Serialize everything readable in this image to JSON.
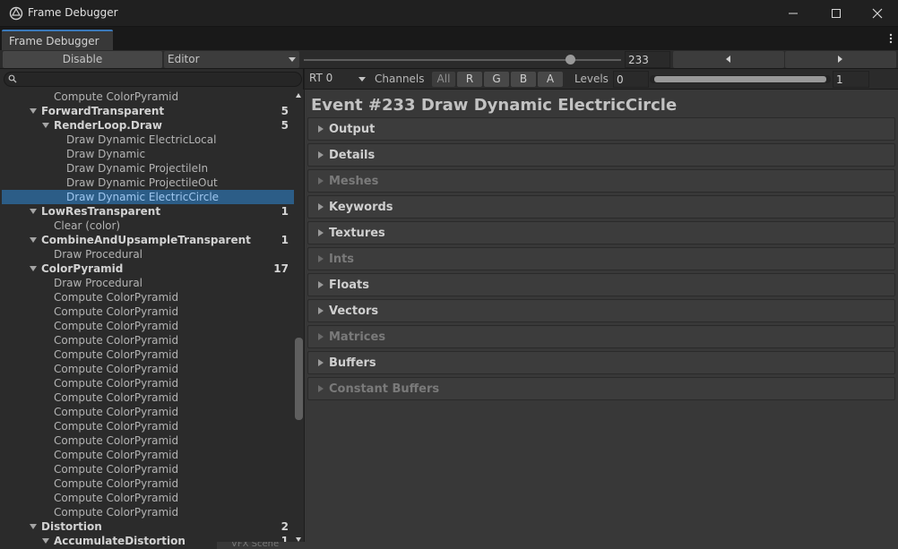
{
  "window": {
    "title": "Frame Debugger"
  },
  "tab": {
    "label": "Frame Debugger"
  },
  "toolbar": {
    "disable_label": "Disable",
    "target_label": "Editor",
    "event_index": "233",
    "slider_position": 0.84
  },
  "search": {
    "value": ""
  },
  "tree": [
    {
      "label": "Compute ColorPyramid",
      "depth": 2,
      "type": "leaf"
    },
    {
      "label": "ForwardTransparent",
      "depth": 1,
      "type": "group",
      "count": "5",
      "expanded": true
    },
    {
      "label": "RenderLoop.Draw",
      "depth": 2,
      "type": "group",
      "count": "5",
      "expanded": true
    },
    {
      "label": "Draw Dynamic ElectricLocal",
      "depth": 3,
      "type": "leaf"
    },
    {
      "label": "Draw Dynamic",
      "depth": 3,
      "type": "leaf"
    },
    {
      "label": "Draw Dynamic ProjectileIn",
      "depth": 3,
      "type": "leaf"
    },
    {
      "label": "Draw Dynamic ProjectileOut",
      "depth": 3,
      "type": "leaf"
    },
    {
      "label": "Draw Dynamic ElectricCircle",
      "depth": 3,
      "type": "leaf",
      "selected": true
    },
    {
      "label": "LowResTransparent",
      "depth": 1,
      "type": "group",
      "count": "1",
      "expanded": true
    },
    {
      "label": "Clear (color)",
      "depth": 2,
      "type": "leaf"
    },
    {
      "label": "CombineAndUpsampleTransparent",
      "depth": 1,
      "type": "group",
      "count": "1",
      "expanded": true
    },
    {
      "label": "Draw Procedural",
      "depth": 2,
      "type": "leaf"
    },
    {
      "label": "ColorPyramid",
      "depth": 1,
      "type": "group",
      "count": "17",
      "expanded": true
    },
    {
      "label": "Draw Procedural",
      "depth": 2,
      "type": "leaf"
    },
    {
      "label": "Compute ColorPyramid",
      "depth": 2,
      "type": "leaf"
    },
    {
      "label": "Compute ColorPyramid",
      "depth": 2,
      "type": "leaf"
    },
    {
      "label": "Compute ColorPyramid",
      "depth": 2,
      "type": "leaf"
    },
    {
      "label": "Compute ColorPyramid",
      "depth": 2,
      "type": "leaf"
    },
    {
      "label": "Compute ColorPyramid",
      "depth": 2,
      "type": "leaf"
    },
    {
      "label": "Compute ColorPyramid",
      "depth": 2,
      "type": "leaf"
    },
    {
      "label": "Compute ColorPyramid",
      "depth": 2,
      "type": "leaf"
    },
    {
      "label": "Compute ColorPyramid",
      "depth": 2,
      "type": "leaf"
    },
    {
      "label": "Compute ColorPyramid",
      "depth": 2,
      "type": "leaf"
    },
    {
      "label": "Compute ColorPyramid",
      "depth": 2,
      "type": "leaf"
    },
    {
      "label": "Compute ColorPyramid",
      "depth": 2,
      "type": "leaf"
    },
    {
      "label": "Compute ColorPyramid",
      "depth": 2,
      "type": "leaf"
    },
    {
      "label": "Compute ColorPyramid",
      "depth": 2,
      "type": "leaf"
    },
    {
      "label": "Compute ColorPyramid",
      "depth": 2,
      "type": "leaf"
    },
    {
      "label": "Compute ColorPyramid",
      "depth": 2,
      "type": "leaf"
    },
    {
      "label": "Compute ColorPyramid",
      "depth": 2,
      "type": "leaf"
    },
    {
      "label": "Distortion",
      "depth": 1,
      "type": "group",
      "count": "2",
      "expanded": true
    },
    {
      "label": "AccumulateDistortion",
      "depth": 2,
      "type": "group",
      "count": "1",
      "expanded": true
    }
  ],
  "bottom_tab": {
    "label": "VFX Scene"
  },
  "render_target": {
    "rt_label": "RT 0",
    "channels_label": "Channels",
    "channels": [
      "All",
      "R",
      "G",
      "B",
      "A"
    ],
    "levels_label": "Levels",
    "level_min": "0",
    "level_max": "1"
  },
  "event": {
    "title": "Event #233 Draw Dynamic ElectricCircle"
  },
  "sections": [
    {
      "name": "Output",
      "enabled": true
    },
    {
      "name": "Details",
      "enabled": true
    },
    {
      "name": "Meshes",
      "enabled": false
    },
    {
      "name": "Keywords",
      "enabled": true
    },
    {
      "name": "Textures",
      "enabled": true
    },
    {
      "name": "Ints",
      "enabled": false
    },
    {
      "name": "Floats",
      "enabled": true
    },
    {
      "name": "Vectors",
      "enabled": true
    },
    {
      "name": "Matrices",
      "enabled": false
    },
    {
      "name": "Buffers",
      "enabled": true
    },
    {
      "name": "Constant Buffers",
      "enabled": false
    }
  ],
  "colors": {
    "selection": "#2c5d87",
    "tab_accent": "#3a79bb"
  }
}
